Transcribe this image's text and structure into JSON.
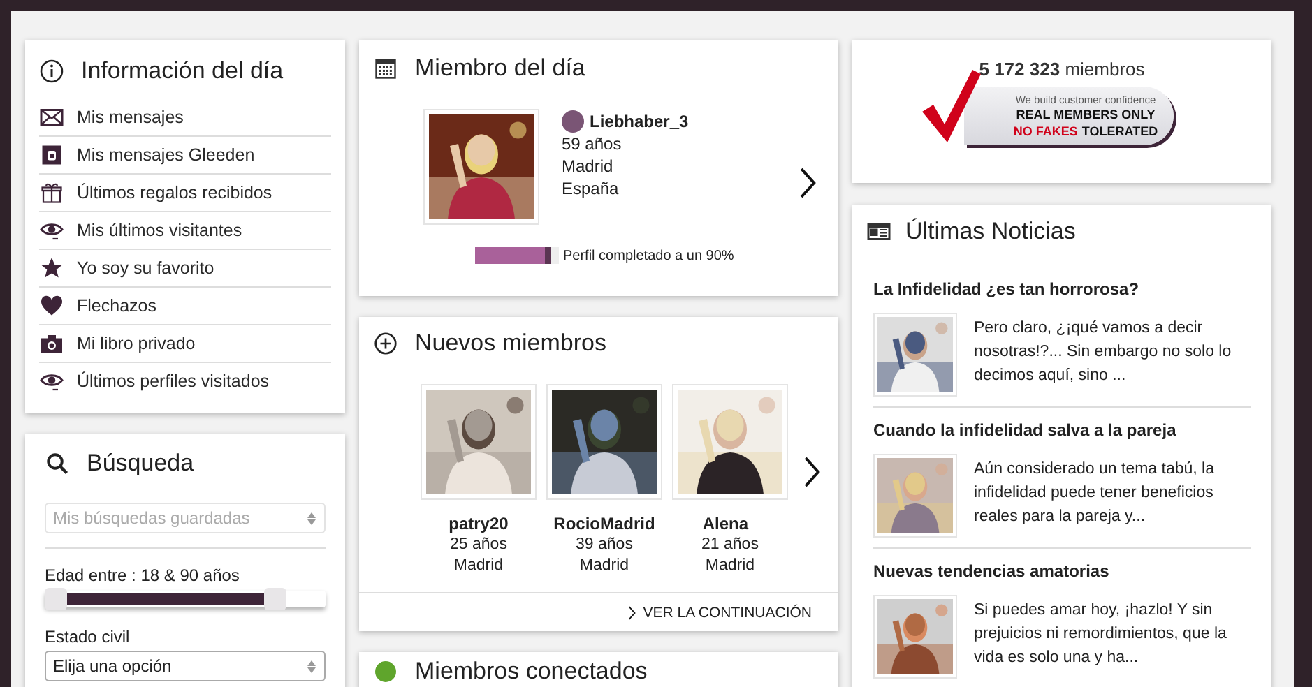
{
  "info_panel": {
    "title": "Información del día",
    "items": [
      {
        "label": "Mis mensajes"
      },
      {
        "label": "Mis mensajes Gleeden"
      },
      {
        "label": "Últimos regalos recibidos"
      },
      {
        "label": "Mis últimos visitantes"
      },
      {
        "label": "Yo soy su favorito"
      },
      {
        "label": "Flechazos"
      },
      {
        "label": "Mi libro privado"
      },
      {
        "label": "Últimos perfiles visitados"
      }
    ]
  },
  "search_panel": {
    "title": "Búsqueda",
    "saved_searches": {
      "placeholder": "Mis búsquedas guardadas"
    },
    "age_label": "Edad entre : 18 & 90 años",
    "age_slider": {
      "level": 0.8
    },
    "marital_label": "Estado civil",
    "marital_select": {
      "value": "Elija una opción"
    }
  },
  "member_of_day": {
    "title": "Miembro del día",
    "name": "Liebhaber_3",
    "color": "#7a5575",
    "age": "59 años",
    "city": "Madrid",
    "country": "España",
    "completion": {
      "level": 0.9,
      "label": "Perfil completado a un 90%"
    }
  },
  "new_members": {
    "title": "Nuevos miembros",
    "members": [
      {
        "name": "patry20",
        "age": "25 años",
        "city": "Madrid"
      },
      {
        "name": "RocioMadrid",
        "age": "39 años",
        "city": "Madrid"
      },
      {
        "name": "Alena_",
        "age": "21 años",
        "city": "Madrid"
      }
    ],
    "more_link": "VER LA CONTINUACIÓN"
  },
  "connected_members": {
    "title": "Miembros conectados"
  },
  "stats": {
    "count": "**5 172 323** miembros",
    "badge": {
      "tagline": "We build customer confidence",
      "line1": "REAL MEMBERS ONLY",
      "line2_alert": "NO FAKES",
      "line2_rest": "TOLERATED"
    }
  },
  "news": {
    "title": "Últimas Noticias",
    "items": [
      {
        "title": "La Infidelidad ¿es tan horrorosa?",
        "excerpt": "Pero claro, ¿¡qué vamos a decir nosotras!?... Sin embargo no solo lo decimos aquí, sino ..."
      },
      {
        "title": "Cuando la infidelidad salva a la pareja",
        "excerpt": "Aún considerado un tema tabú, la infidelidad puede tener beneficios reales para la pareja y..."
      },
      {
        "title": "Nuevas tendencias amatorias",
        "excerpt": "Si puedes amar hoy, ¡hazlo! Y sin prejuicios ni remordimientos, que la vida es solo una y ha..."
      }
    ]
  }
}
